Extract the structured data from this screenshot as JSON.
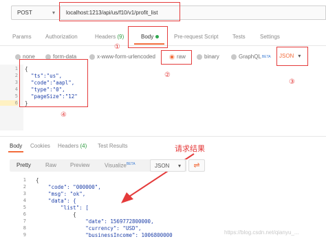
{
  "request": {
    "method": "POST",
    "url": "localhost:1213/api/us/f10/v1/profit_list"
  },
  "request_tabs": [
    {
      "label": "Params"
    },
    {
      "label": "Authorization"
    },
    {
      "label": "Headers",
      "count": "(9)"
    },
    {
      "label": "Body"
    },
    {
      "label": "Pre-request Script"
    },
    {
      "label": "Tests"
    },
    {
      "label": "Settings"
    }
  ],
  "body_types": [
    {
      "label": "none"
    },
    {
      "label": "form-data"
    },
    {
      "label": "x-www-form-urlencoded"
    },
    {
      "label": "raw"
    },
    {
      "label": "binary"
    },
    {
      "label": "GraphQL",
      "badge": "BETA"
    }
  ],
  "raw_format": "JSON",
  "request_body": {
    "line_numbers": [
      "1",
      "2",
      "3",
      "4",
      "5",
      "6"
    ],
    "lines": [
      "{",
      "  \"ts\":\"us\",",
      "  \"code\":\"aapl\",",
      "  \"type\":\"0\",",
      "  \"pageSize\":\"12\"",
      "}"
    ]
  },
  "annotations": {
    "n1": "①",
    "n2": "②",
    "n3": "③",
    "n4": "④",
    "result_label": "请求结果"
  },
  "response_tabs": [
    {
      "label": "Body"
    },
    {
      "label": "Cookies"
    },
    {
      "label": "Headers",
      "count": "(4)"
    },
    {
      "label": "Test Results"
    }
  ],
  "response_views": [
    {
      "label": "Pretty"
    },
    {
      "label": "Raw"
    },
    {
      "label": "Preview"
    },
    {
      "label": "Visualize",
      "badge": "BETA"
    }
  ],
  "response_format": "JSON",
  "response_body": {
    "line_numbers": [
      "1",
      "2",
      "3",
      "4",
      "5",
      "6",
      "7",
      "8",
      "9"
    ],
    "lines": [
      "{",
      "    \"code\": \"000000\",",
      "    \"msg\": \"ok\",",
      "    \"data\": {",
      "        \"list\": [",
      "            {",
      "                \"date\": 1569772800000,",
      "                \"currency\": \"USD\",",
      "                \"businessIncome\": 1006800000"
    ]
  },
  "watermark": "https://blog.csdn.net/qianyu_..."
}
